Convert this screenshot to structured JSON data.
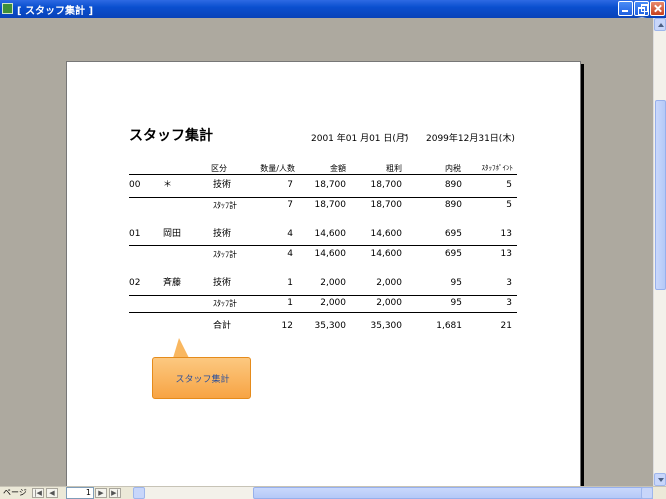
{
  "window": {
    "title": "[ スタッフ集計 ]"
  },
  "report": {
    "title": "スタッフ集計",
    "date_from": "2001 年01 月01 日(月)",
    "date_sep": "~",
    "date_to": "2099年12月31日(木)",
    "headers": {
      "category": "区分",
      "quantity": "数量/人数",
      "amount": "金額",
      "profit": "粗利",
      "tax": "内税",
      "points": "ｽﾀｯﾌﾎﾟｲﾝﾄ"
    },
    "rows": [
      {
        "code": "00",
        "name": "＊",
        "category": "技術",
        "quantity": "7",
        "amount": "18,700",
        "profit": "18,700",
        "tax": "890",
        "points": "5"
      },
      {
        "code": "",
        "name": "",
        "category": "ｽﾀｯﾌ計",
        "quantity": "7",
        "amount": "18,700",
        "profit": "18,700",
        "tax": "890",
        "points": "5"
      },
      {
        "code": "01",
        "name": "岡田",
        "category": "技術",
        "quantity": "4",
        "amount": "14,600",
        "profit": "14,600",
        "tax": "695",
        "points": "13"
      },
      {
        "code": "",
        "name": "",
        "category": "ｽﾀｯﾌ計",
        "quantity": "4",
        "amount": "14,600",
        "profit": "14,600",
        "tax": "695",
        "points": "13"
      },
      {
        "code": "02",
        "name": "斉藤",
        "category": "技術",
        "quantity": "1",
        "amount": "2,000",
        "profit": "2,000",
        "tax": "95",
        "points": "3"
      },
      {
        "code": "",
        "name": "",
        "category": "ｽﾀｯﾌ計",
        "quantity": "1",
        "amount": "2,000",
        "profit": "2,000",
        "tax": "95",
        "points": "3"
      },
      {
        "code": "",
        "name": "",
        "category": "合計",
        "quantity": "12",
        "amount": "35,300",
        "profit": "35,300",
        "tax": "1,681",
        "points": "21"
      }
    ]
  },
  "callout": {
    "text": "スタッフ集計"
  },
  "navigation": {
    "page_label": "ページ",
    "page_value": "1",
    "first": "|◀",
    "prev": "◀",
    "next": "▶",
    "last": "▶|"
  },
  "colors": {
    "titlebar": "#0a4fcf",
    "background": "#ada99f",
    "callout": "#f7a444",
    "callout_text": "#2a4f9c"
  }
}
